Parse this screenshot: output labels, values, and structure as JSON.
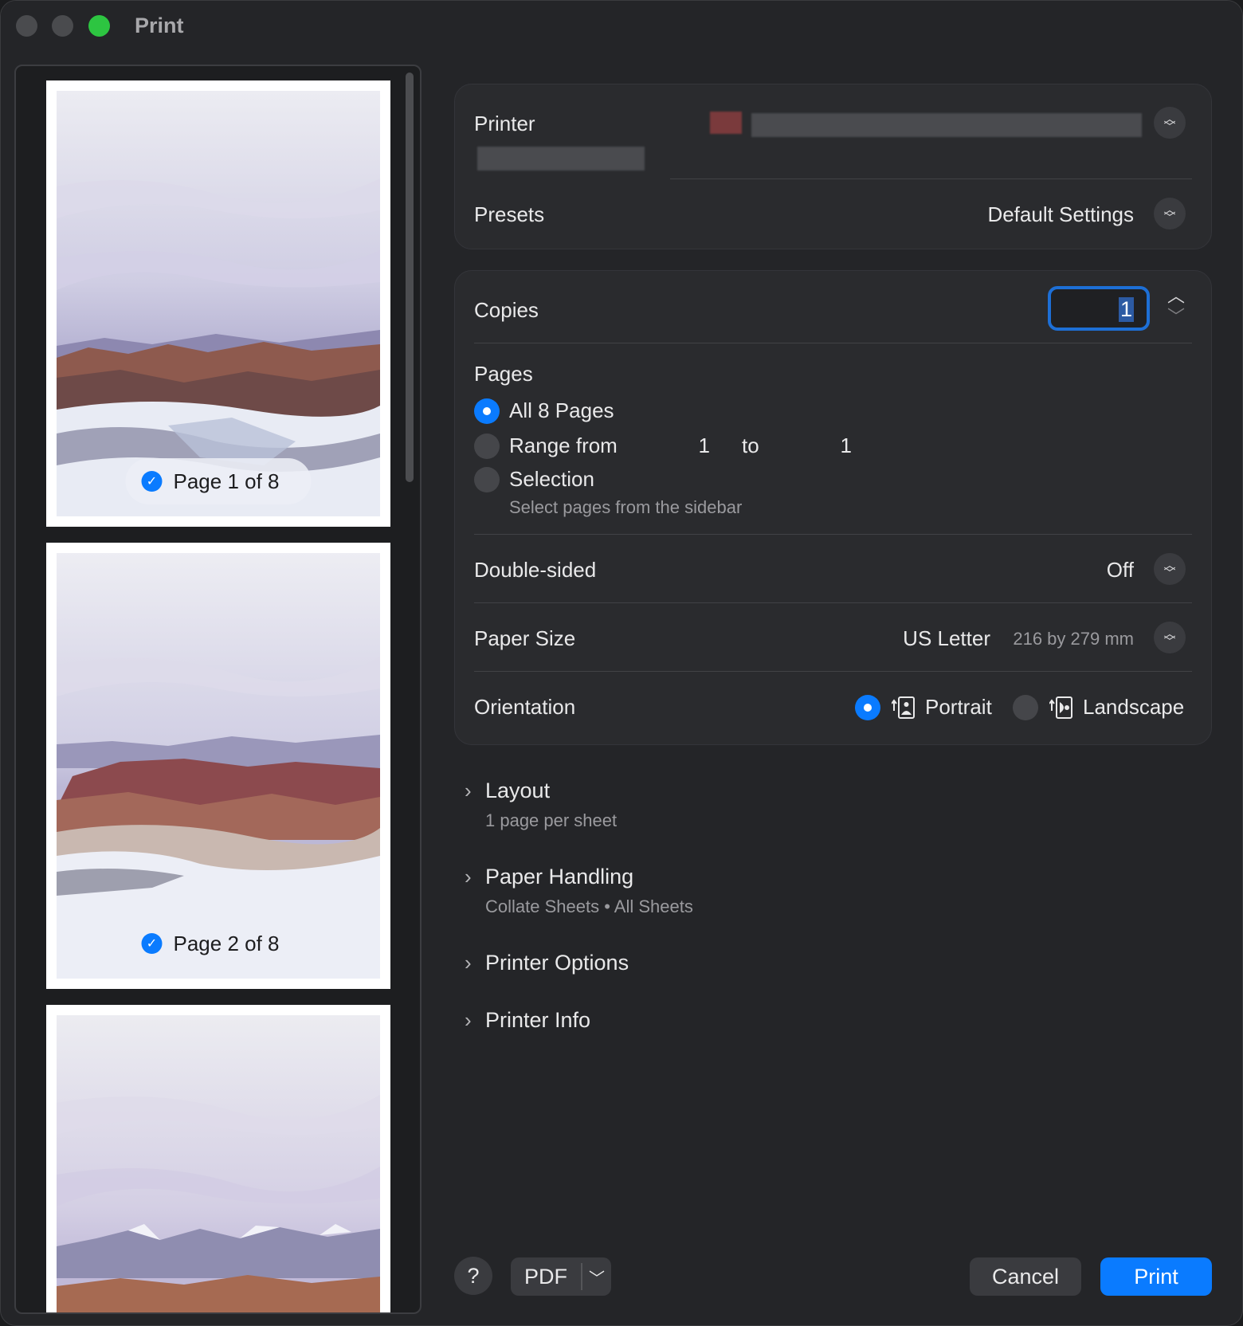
{
  "window": {
    "title": "Print"
  },
  "sidebar": {
    "pages": [
      {
        "label": "Page 1 of 8",
        "checked": true
      },
      {
        "label": "Page 2 of 8",
        "checked": true
      },
      {
        "label": "",
        "checked": false
      }
    ]
  },
  "printer_card": {
    "printer_label": "Printer",
    "presets_label": "Presets",
    "presets_value": "Default Settings"
  },
  "settings_card": {
    "copies_label": "Copies",
    "copies_value": "1",
    "pages_label": "Pages",
    "all_pages": "All 8 Pages",
    "range_from": "Range from",
    "range_start": "1",
    "range_to": "to",
    "range_end": "1",
    "selection": "Selection",
    "selection_hint": "Select pages from the sidebar",
    "double_sided_label": "Double-sided",
    "double_sided_value": "Off",
    "paper_size_label": "Paper Size",
    "paper_size_value": "US Letter",
    "paper_size_dims": "216 by 279 mm",
    "orientation_label": "Orientation",
    "portrait": "Portrait",
    "landscape": "Landscape"
  },
  "sections": {
    "layout_title": "Layout",
    "layout_sub": "1 page per sheet",
    "paper_handling_title": "Paper Handling",
    "paper_handling_sub": "Collate Sheets • All Sheets",
    "printer_options_title": "Printer Options",
    "printer_info_title": "Printer Info"
  },
  "footer": {
    "help": "?",
    "pdf": "PDF",
    "cancel": "Cancel",
    "print": "Print"
  },
  "colors": {
    "accent": "#0a7bff",
    "window_bg": "#242528",
    "card_bg": "#2a2b2e"
  }
}
